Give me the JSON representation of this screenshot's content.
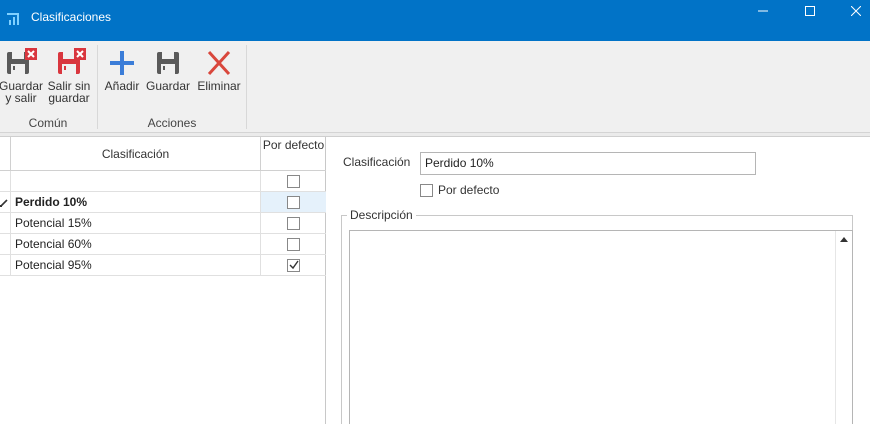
{
  "window": {
    "title": "Clasificaciones",
    "accent_color": "#0173c7"
  },
  "ribbon": {
    "groups": [
      {
        "label": "Común",
        "buttons": [
          {
            "label": "Guardar y salir",
            "icon": "save-close-icon"
          },
          {
            "label": "Salir sin guardar",
            "icon": "exit-no-save-icon"
          }
        ]
      },
      {
        "label": "Acciones",
        "buttons": [
          {
            "label": "Añadir",
            "icon": "plus-icon"
          },
          {
            "label": "Guardar",
            "icon": "save-icon"
          },
          {
            "label": "Eliminar",
            "icon": "delete-x-icon"
          }
        ]
      }
    ]
  },
  "grid": {
    "columns": [
      "Clasificación",
      "Por defecto"
    ],
    "rows": [
      {
        "name": "",
        "por_defecto": false,
        "new_row": true
      },
      {
        "name": "Perdido 10%",
        "por_defecto": false,
        "selected": true,
        "editing": true
      },
      {
        "name": "Potencial 15%",
        "por_defecto": false
      },
      {
        "name": "Potencial 60%",
        "por_defecto": false
      },
      {
        "name": "Potencial 95%",
        "por_defecto": true
      }
    ]
  },
  "form": {
    "clasificacion_label": "Clasificación",
    "clasificacion_value": "Perdido 10%",
    "por_defecto_label": "Por defecto",
    "por_defecto_checked": false,
    "descripcion_label": "Descripción",
    "descripcion_value": ""
  }
}
